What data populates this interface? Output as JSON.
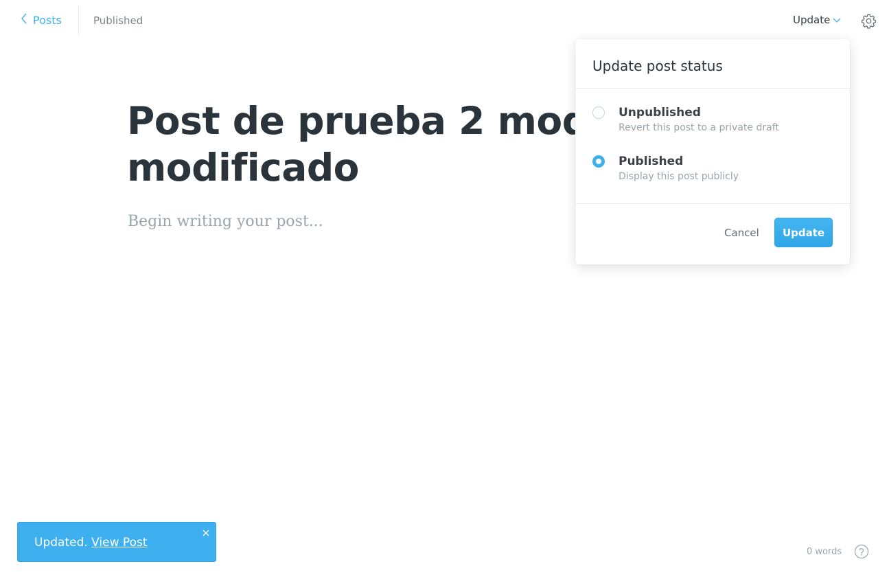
{
  "header": {
    "back_label": "Posts",
    "status": "Published",
    "update_trigger_label": "Update",
    "icons": {
      "back": "chevron-left-icon",
      "update_trigger": "chevron-down-icon",
      "settings": "gear-icon"
    }
  },
  "editor": {
    "title_line_1": "Post de prueba 2 modificado",
    "title_line_2": "modificado",
    "body_placeholder": "Begin writing your post..."
  },
  "popover": {
    "title": "Update post status",
    "options": [
      {
        "label": "Unpublished",
        "description": "Revert this post to a private draft",
        "selected": false
      },
      {
        "label": "Published",
        "description": "Display this post publicly",
        "selected": true
      }
    ],
    "cancel_label": "Cancel",
    "update_label": "Update"
  },
  "notification": {
    "message": "Updated.",
    "link_label": "View Post",
    "close_icon": "close-icon"
  },
  "footer": {
    "word_count": "0 words",
    "help_icon": "help-circle-icon"
  },
  "colors": {
    "accent": "#3eb0ef",
    "title_text": "#2b343a",
    "muted_text": "#9aa5ab",
    "border": "#e5eff5"
  }
}
